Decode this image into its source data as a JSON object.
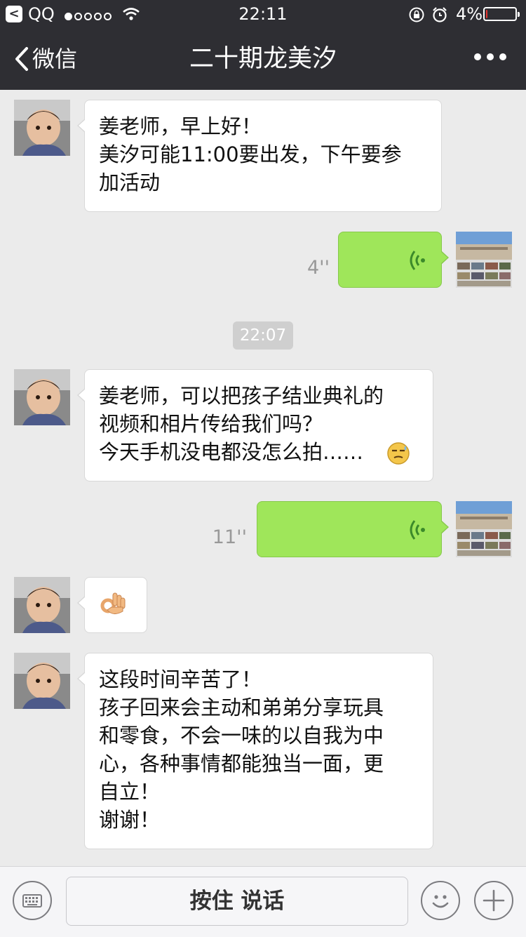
{
  "status_bar": {
    "back_app_glyph": "<",
    "carrier": "QQ",
    "signal_strength": 1,
    "signal_max": 5,
    "time": "22:11",
    "battery_percent": "4%",
    "battery_level": 0.04,
    "icons": [
      "back-to-app-icon",
      "wifi-icon",
      "orientation-lock-icon",
      "alarm-icon",
      "battery-icon"
    ]
  },
  "nav_bar": {
    "back_label": "微信",
    "title": "二十期龙美汐",
    "more_icon": "more-dots-icon"
  },
  "messages": [
    {
      "side": "in",
      "type": "text",
      "text": "姜老师，早上好！\n美汐可能11:00要出发，下午要参\n加活动"
    },
    {
      "side": "out",
      "type": "voice",
      "duration": "4''"
    },
    {
      "type": "timestamp",
      "text": "22:07"
    },
    {
      "side": "in",
      "type": "text",
      "text": "姜老师，可以把孩子结业典礼的\n视频和相片传给我们吗？\n今天手机没电都没怎么拍……",
      "emoji": "awkward-sweat-emoji"
    },
    {
      "side": "out",
      "type": "voice",
      "duration": "11''"
    },
    {
      "side": "in",
      "type": "emoji",
      "emoji": "ok-hand-emoji"
    },
    {
      "side": "in",
      "type": "text",
      "text": "这段时间辛苦了！\n孩子回来会主动和弟弟分享玩具\n和零食，不会一味的以自我为中\n心，各种事情都能独当一面，更\n自立！\n谢谢！"
    }
  ],
  "input_bar": {
    "keyboard_icon": "keyboard-icon",
    "hold_to_talk_label": "按住 说话",
    "emoji_icon": "smiley-icon",
    "plus_icon": "plus-icon"
  },
  "colors": {
    "nav_background": "#2e2e33",
    "chat_background": "#ebebeb",
    "outgoing_bubble": "#9fe65a",
    "incoming_bubble": "#ffffff",
    "voice_wave": "#3b8a2a",
    "battery_low": "#e3342f"
  }
}
